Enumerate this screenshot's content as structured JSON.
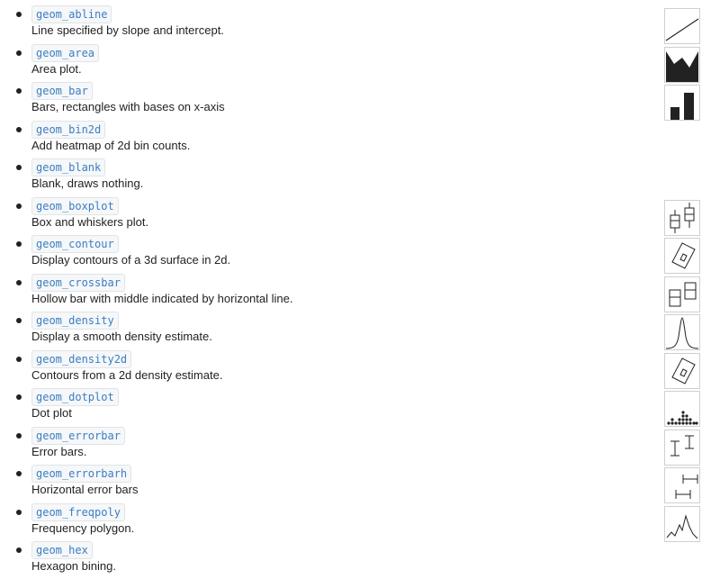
{
  "items": [
    {
      "name": "geom_abline",
      "desc": "Line specified by slope and intercept.",
      "icon": "abline-icon"
    },
    {
      "name": "geom_area",
      "desc": "Area plot.",
      "icon": "area-icon"
    },
    {
      "name": "geom_bar",
      "desc": "Bars, rectangles with bases on x-axis",
      "icon": "bar-icon"
    },
    {
      "name": "geom_bin2d",
      "desc": "Add heatmap of 2d bin counts.",
      "icon": ""
    },
    {
      "name": "geom_blank",
      "desc": "Blank, draws nothing.",
      "icon": ""
    },
    {
      "name": "geom_boxplot",
      "desc": "Box and whiskers plot.",
      "icon": "boxplot-icon"
    },
    {
      "name": "geom_contour",
      "desc": "Display contours of a 3d surface in 2d.",
      "icon": "contour-icon"
    },
    {
      "name": "geom_crossbar",
      "desc": "Hollow bar with middle indicated by horizontal line.",
      "icon": "crossbar-icon"
    },
    {
      "name": "geom_density",
      "desc": "Display a smooth density estimate.",
      "icon": "density-icon"
    },
    {
      "name": "geom_density2d",
      "desc": "Contours from a 2d density estimate.",
      "icon": "density2d-icon"
    },
    {
      "name": "geom_dotplot",
      "desc": "Dot plot",
      "icon": "dotplot-icon"
    },
    {
      "name": "geom_errorbar",
      "desc": "Error bars.",
      "icon": "errorbar-icon"
    },
    {
      "name": "geom_errorbarh",
      "desc": "Horizontal error bars",
      "icon": "errorbarh-icon"
    },
    {
      "name": "geom_freqpoly",
      "desc": "Frequency polygon.",
      "icon": "freqpoly-icon"
    },
    {
      "name": "geom_hex",
      "desc": "Hexagon bining.",
      "icon": ""
    }
  ]
}
